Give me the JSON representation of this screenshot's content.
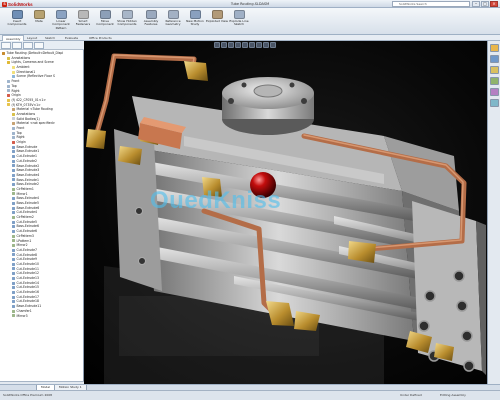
{
  "app": {
    "logo_text": "SolidWorks",
    "window_title": "Tube Routing.SLDASM",
    "search_placeholder": "SolidWorks Search"
  },
  "ribbon": {
    "buttons": [
      {
        "label": "Insert Components",
        "color": "#6f8fb6"
      },
      {
        "label": "Mate",
        "color": "#b7a271"
      },
      {
        "label": "Linear Component Pattern",
        "color": "#8aa2c2"
      },
      {
        "label": "Smart Fasteners",
        "color": "#b8b8b8"
      },
      {
        "label": "Move Component",
        "color": "#8c9fb8"
      },
      {
        "label": "Show Hidden Components",
        "color": "#a8b6c8"
      },
      {
        "label": "Assembly Features",
        "color": "#9aa9be"
      },
      {
        "label": "Reference Geometry",
        "color": "#a3b1c4"
      },
      {
        "label": "New Motion Study",
        "color": "#89a0bf"
      },
      {
        "label": "Exploded View",
        "color": "#b29a78"
      },
      {
        "label": "Explode Line Sketch",
        "color": "#9fb0c6"
      }
    ]
  },
  "command_tabs": [
    "Assembly",
    "Layout",
    "Sketch",
    "Evaluate",
    "Office Products"
  ],
  "feature_tree": [
    {
      "label": "Tube Routing (Default<Default_Displ",
      "depth": 0,
      "icon": "#c78b2f"
    },
    {
      "label": "Annotations",
      "depth": 1,
      "icon": "#d7c04a"
    },
    {
      "label": "Lights, Cameras and Scene",
      "depth": 1,
      "icon": "#e0b934"
    },
    {
      "label": "Ambient",
      "depth": 2,
      "icon": "#f1e07a"
    },
    {
      "label": "Directional1",
      "depth": 2,
      "icon": "#f1e07a"
    },
    {
      "label": "Scene (Reflective Floor S",
      "depth": 2,
      "icon": "#8cb5d8"
    },
    {
      "label": "Front",
      "depth": 1,
      "icon": "#9fb4cc"
    },
    {
      "label": "Top",
      "depth": 1,
      "icon": "#9fb4cc"
    },
    {
      "label": "Right",
      "depth": 1,
      "icon": "#9fb4cc"
    },
    {
      "label": "Origin",
      "depth": 1,
      "icon": "#d35b4a"
    },
    {
      "label": "(f) 422_CF055_01<1>",
      "depth": 1,
      "icon": "#e7c34b"
    },
    {
      "label": "(f) KTH_0735V<1>",
      "depth": 1,
      "icon": "#e7c34b"
    },
    {
      "label": "Material <Tube Routing",
      "depth": 2,
      "icon": "#c6a273"
    },
    {
      "label": "Annotations",
      "depth": 2,
      "icon": "#d7c04a"
    },
    {
      "label": "Solid Bodies(1)",
      "depth": 2,
      "icon": "#c8cfd8"
    },
    {
      "label": "Material <not specified>",
      "depth": 2,
      "icon": "#c6a273"
    },
    {
      "label": "Front",
      "depth": 2,
      "icon": "#9fb4cc"
    },
    {
      "label": "Top",
      "depth": 2,
      "icon": "#9fb4cc"
    },
    {
      "label": "Right",
      "depth": 2,
      "icon": "#9fb4cc"
    },
    {
      "label": "Origin",
      "depth": 2,
      "icon": "#d35b4a"
    },
    {
      "label": "Base-Extrude",
      "depth": 2,
      "icon": "#7e9fc6"
    },
    {
      "label": "Base-Extrude1",
      "depth": 2,
      "icon": "#7e9fc6"
    },
    {
      "label": "Cut-Extrude1",
      "depth": 2,
      "icon": "#7e9fc6"
    },
    {
      "label": "Cut-Extrude2",
      "depth": 2,
      "icon": "#7e9fc6"
    },
    {
      "label": "Base-Extrude2",
      "depth": 2,
      "icon": "#7e9fc6"
    },
    {
      "label": "Base-Extrude3",
      "depth": 2,
      "icon": "#7e9fc6"
    },
    {
      "label": "Base-Extrude4",
      "depth": 2,
      "icon": "#7e9fc6"
    },
    {
      "label": "Boss-Extrude1",
      "depth": 2,
      "icon": "#7e9fc6"
    },
    {
      "label": "Boss-Extrude2",
      "depth": 2,
      "icon": "#7e9fc6"
    },
    {
      "label": "CirPattern1",
      "depth": 2,
      "icon": "#9cb68a"
    },
    {
      "label": "Mirror1",
      "depth": 2,
      "icon": "#9cb68a"
    },
    {
      "label": "Boss-Extrude4",
      "depth": 2,
      "icon": "#7e9fc6"
    },
    {
      "label": "Boss-Extrude5",
      "depth": 2,
      "icon": "#7e9fc6"
    },
    {
      "label": "Base-Extrude6",
      "depth": 2,
      "icon": "#7e9fc6"
    },
    {
      "label": "Cut-Extrude4",
      "depth": 2,
      "icon": "#7e9fc6"
    },
    {
      "label": "CirPattern2",
      "depth": 2,
      "icon": "#9cb68a"
    },
    {
      "label": "Cut-Extrude5",
      "depth": 2,
      "icon": "#7e9fc6"
    },
    {
      "label": "Boss-Extrude6",
      "depth": 2,
      "icon": "#7e9fc6"
    },
    {
      "label": "Cut-Extrude6",
      "depth": 2,
      "icon": "#7e9fc6"
    },
    {
      "label": "CirPattern3",
      "depth": 2,
      "icon": "#9cb68a"
    },
    {
      "label": "LPattern1",
      "depth": 2,
      "icon": "#9cb68a"
    },
    {
      "label": "Mirror2",
      "depth": 2,
      "icon": "#9cb68a"
    },
    {
      "label": "Cut-Extrude7",
      "depth": 2,
      "icon": "#7e9fc6"
    },
    {
      "label": "Cut-Extrude8",
      "depth": 2,
      "icon": "#7e9fc6"
    },
    {
      "label": "Cut-Extrude9",
      "depth": 2,
      "icon": "#7e9fc6"
    },
    {
      "label": "Cut-Extrude10",
      "depth": 2,
      "icon": "#7e9fc6"
    },
    {
      "label": "Cut-Extrude11",
      "depth": 2,
      "icon": "#7e9fc6"
    },
    {
      "label": "Cut-Extrude12",
      "depth": 2,
      "icon": "#7e9fc6"
    },
    {
      "label": "Cut-Extrude13",
      "depth": 2,
      "icon": "#7e9fc6"
    },
    {
      "label": "Cut-Extrude14",
      "depth": 2,
      "icon": "#7e9fc6"
    },
    {
      "label": "Cut-Extrude15",
      "depth": 2,
      "icon": "#7e9fc6"
    },
    {
      "label": "Cut-Extrude16",
      "depth": 2,
      "icon": "#7e9fc6"
    },
    {
      "label": "Cut-Extrude17",
      "depth": 2,
      "icon": "#7e9fc6"
    },
    {
      "label": "Cut-Extrude18",
      "depth": 2,
      "icon": "#7e9fc6"
    },
    {
      "label": "Base-Extrude11",
      "depth": 2,
      "icon": "#7e9fc6"
    },
    {
      "label": "Chamfer1",
      "depth": 2,
      "icon": "#9cb68a"
    },
    {
      "label": "Mirror3",
      "depth": 2,
      "icon": "#9cb68a"
    }
  ],
  "viewport": {
    "watermark": "OuedKniss"
  },
  "sheet_tabs": [
    "Model",
    "Motion Study 1"
  ],
  "status": {
    "left": "SolidWorks Office Premium 2008",
    "state": "Under Defined",
    "mode": "Editing Assembly"
  }
}
